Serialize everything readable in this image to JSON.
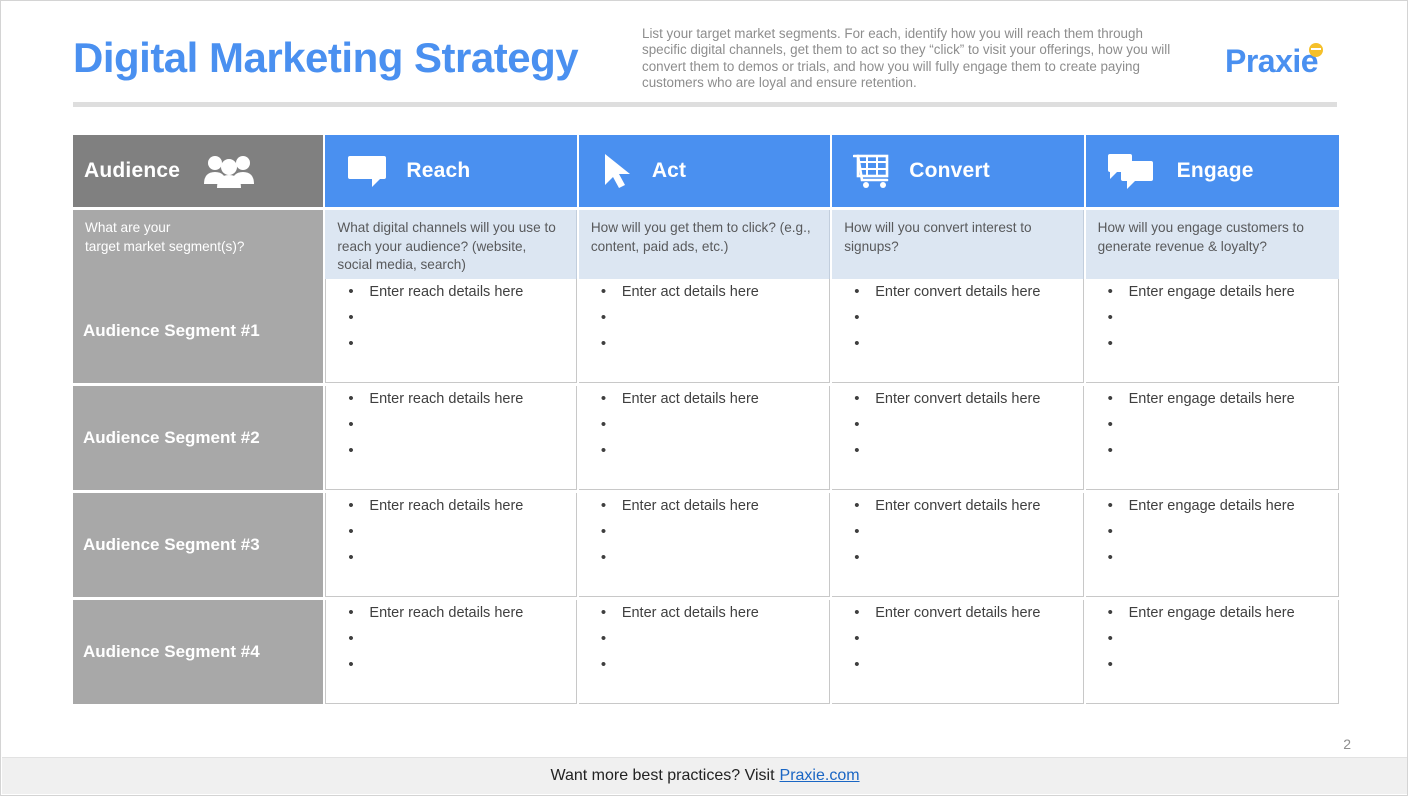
{
  "header": {
    "title": "Digital Marketing Strategy",
    "intro": "List your target market segments. For each, identify how you will reach them through specific digital channels, get them to act so they “click” to visit your offerings, how you will convert them to demos or trials, and how you will fully engage them to create paying customers who are loyal and ensure retention.",
    "logo": "Praxie",
    "logo_dot_icon": "praxie-dot-icon"
  },
  "colors": {
    "brand_blue": "#4a90f0",
    "header_gray": "#808080",
    "row_gray": "#a8a8a8",
    "prompt_blue": "#dce6f2",
    "logo_dot": "#f5c02a",
    "link_blue": "#1a66c4"
  },
  "matrix": {
    "columns": [
      {
        "label": "Audience",
        "icon": "people-group-icon",
        "prompt": "What are your\ntarget market segment(s)?"
      },
      {
        "label": "Reach",
        "icon": "speech-bubble-icon",
        "prompt": "What digital channels will you use to reach your audience? (website, social media, search)"
      },
      {
        "label": "Act",
        "icon": "cursor-arrow-icon",
        "prompt": "How will you get them to click? (e.g., content, paid ads, etc.)"
      },
      {
        "label": "Convert",
        "icon": "shopping-cart-icon",
        "prompt": "How will you convert interest to signups?"
      },
      {
        "label": "Engage",
        "icon": "double-speech-bubble-icon",
        "prompt": "How will you engage customers to generate revenue & loyalty?"
      }
    ],
    "prompt_line1_col0": "What are your",
    "prompt_line2_col0": "target market segment(s)?",
    "rows": [
      {
        "segment": "Audience Segment #1",
        "cells": [
          [
            "Enter reach details here",
            "",
            ""
          ],
          [
            "Enter act details here",
            "",
            ""
          ],
          [
            "Enter convert details here",
            "",
            ""
          ],
          [
            "Enter engage details here",
            "",
            ""
          ]
        ]
      },
      {
        "segment": "Audience Segment #2",
        "cells": [
          [
            "Enter reach details here",
            "",
            ""
          ],
          [
            "Enter act details here",
            "",
            ""
          ],
          [
            "Enter convert details here",
            "",
            ""
          ],
          [
            "Enter engage details here",
            "",
            ""
          ]
        ]
      },
      {
        "segment": "Audience Segment #3",
        "cells": [
          [
            "Enter reach details here",
            "",
            ""
          ],
          [
            "Enter act details here",
            "",
            ""
          ],
          [
            "Enter convert details here",
            "",
            ""
          ],
          [
            "Enter engage details here",
            "",
            ""
          ]
        ]
      },
      {
        "segment": "Audience Segment #4",
        "cells": [
          [
            "Enter reach details here",
            "",
            ""
          ],
          [
            "Enter act details here",
            "",
            ""
          ],
          [
            "Enter convert details here",
            "",
            ""
          ],
          [
            "Enter engage details here",
            "",
            ""
          ]
        ]
      }
    ]
  },
  "footer": {
    "text": "Want more best practices? Visit",
    "link": "Praxie.com",
    "page_number": "2"
  }
}
